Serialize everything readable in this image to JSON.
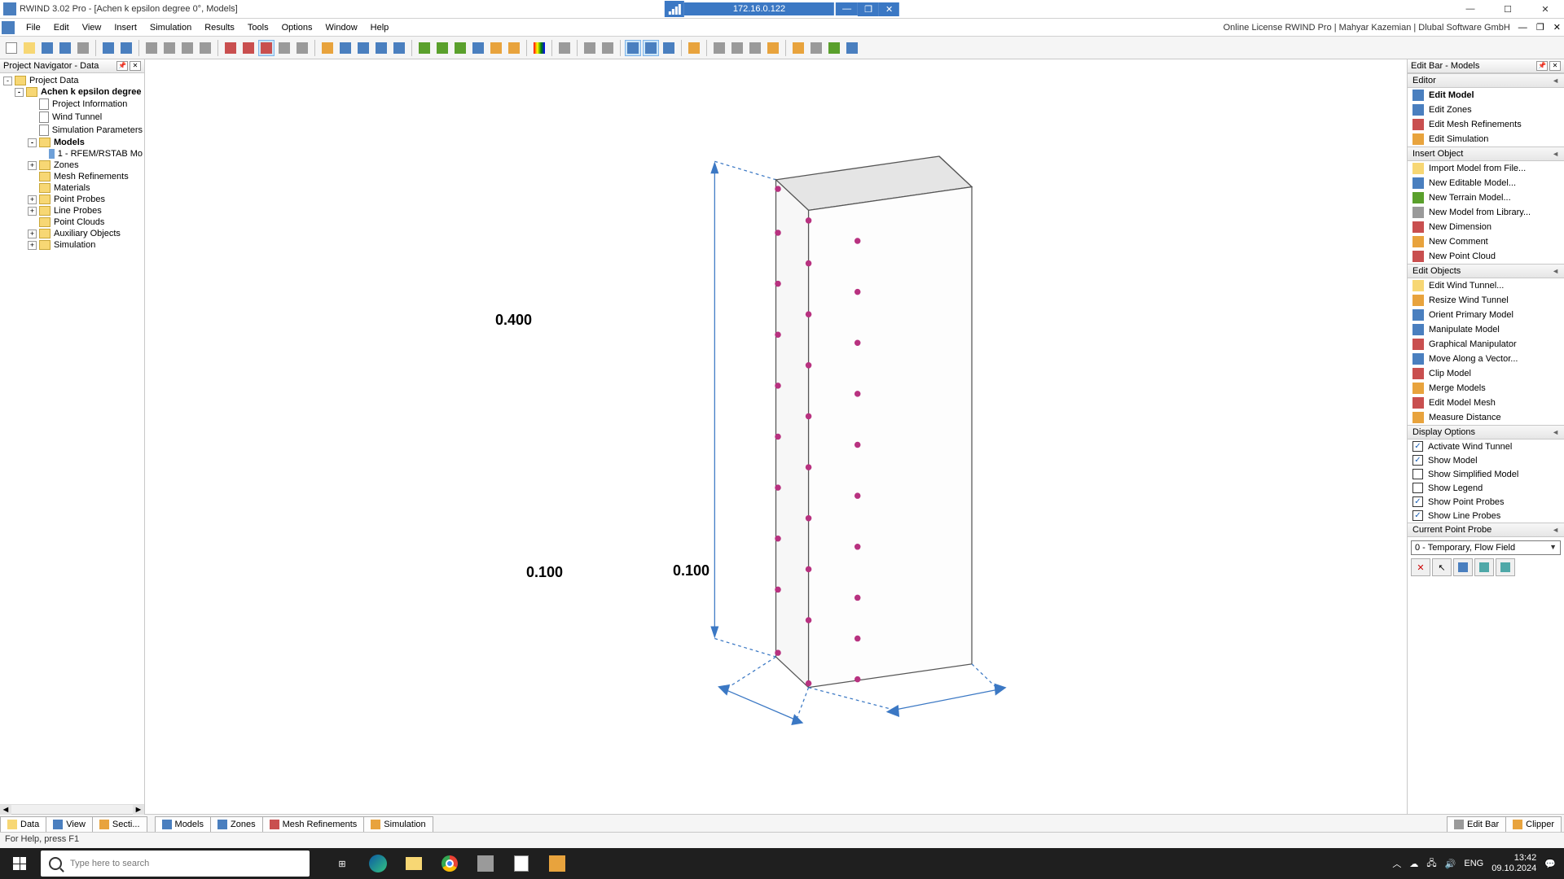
{
  "titlebar": {
    "app_title": "RWIND 3.02 Pro - [Achen  k epsilon degree 0°, Models]",
    "center_ip": "172.16.0.122"
  },
  "menubar": {
    "items": [
      "File",
      "Edit",
      "View",
      "Insert",
      "Simulation",
      "Results",
      "Tools",
      "Options",
      "Window",
      "Help"
    ],
    "license": "Online License RWIND Pro | Mahyar Kazemian | Dlubal Software GmbH"
  },
  "left_panel": {
    "title": "Project Navigator - Data",
    "tree": [
      {
        "level": 0,
        "icon": "folder",
        "label": "Project Data",
        "expander": "-"
      },
      {
        "level": 1,
        "icon": "folder",
        "label": "Achen  k epsilon degree",
        "expander": "-",
        "bold": true
      },
      {
        "level": 2,
        "icon": "doc",
        "label": "Project Information",
        "expander": ""
      },
      {
        "level": 2,
        "icon": "doc",
        "label": "Wind Tunnel",
        "expander": ""
      },
      {
        "level": 2,
        "icon": "doc",
        "label": "Simulation Parameters",
        "expander": ""
      },
      {
        "level": 2,
        "icon": "folder",
        "label": "Models",
        "expander": "-",
        "bold": true
      },
      {
        "level": 3,
        "icon": "cube",
        "label": "1 - RFEM/RSTAB Mo",
        "expander": ""
      },
      {
        "level": 2,
        "icon": "folder",
        "label": "Zones",
        "expander": "+"
      },
      {
        "level": 2,
        "icon": "folder",
        "label": "Mesh Refinements",
        "expander": ""
      },
      {
        "level": 2,
        "icon": "folder",
        "label": "Materials",
        "expander": ""
      },
      {
        "level": 2,
        "icon": "folder",
        "label": "Point Probes",
        "expander": "+"
      },
      {
        "level": 2,
        "icon": "folder",
        "label": "Line Probes",
        "expander": "+"
      },
      {
        "level": 2,
        "icon": "folder",
        "label": "Point Clouds",
        "expander": ""
      },
      {
        "level": 2,
        "icon": "folder",
        "label": "Auxiliary Objects",
        "expander": "+"
      },
      {
        "level": 2,
        "icon": "folder",
        "label": "Simulation",
        "expander": "+"
      }
    ]
  },
  "viewport": {
    "dim_height": "0.400",
    "dim_width": "0.100",
    "dim_depth": "0.100"
  },
  "right_panel": {
    "title": "Edit Bar - Models",
    "editor": {
      "header": "Editor",
      "items": [
        {
          "label": "Edit Model",
          "bold": true,
          "color": "#4a7fbf"
        },
        {
          "label": "Edit Zones",
          "color": "#4a7fbf"
        },
        {
          "label": "Edit Mesh Refinements",
          "color": "#c94f4f"
        },
        {
          "label": "Edit Simulation",
          "color": "#e8a33d"
        }
      ]
    },
    "insert": {
      "header": "Insert Object",
      "items": [
        {
          "label": "Import Model from File...",
          "color": "#f7d774"
        },
        {
          "label": "New Editable Model...",
          "color": "#4a7fbf"
        },
        {
          "label": "New Terrain Model...",
          "color": "#5aa02c"
        },
        {
          "label": "New Model from Library...",
          "color": "#9a9a9a"
        },
        {
          "label": "New Dimension",
          "color": "#c94f4f"
        },
        {
          "label": "New Comment",
          "color": "#e8a33d"
        },
        {
          "label": "New Point Cloud",
          "color": "#c94f4f"
        }
      ]
    },
    "edit_objects": {
      "header": "Edit Objects",
      "items": [
        {
          "label": "Edit Wind Tunnel...",
          "color": "#f7d774"
        },
        {
          "label": "Resize Wind Tunnel",
          "color": "#e8a33d"
        },
        {
          "label": "Orient Primary Model",
          "color": "#4a7fbf"
        },
        {
          "label": "Manipulate Model",
          "color": "#4a7fbf"
        },
        {
          "label": "Graphical Manipulator",
          "color": "#c94f4f"
        },
        {
          "label": "Move Along a Vector...",
          "color": "#4a7fbf"
        },
        {
          "label": "Clip Model",
          "color": "#c94f4f"
        },
        {
          "label": "Merge Models",
          "color": "#e8a33d"
        },
        {
          "label": "Edit Model Mesh",
          "color": "#c94f4f"
        },
        {
          "label": "Measure Distance",
          "color": "#e8a33d"
        }
      ]
    },
    "display": {
      "header": "Display Options",
      "items": [
        {
          "label": "Activate Wind Tunnel",
          "checked": true
        },
        {
          "label": "Show Model",
          "checked": true
        },
        {
          "label": "Show Simplified Model",
          "checked": false
        },
        {
          "label": "Show Legend",
          "checked": false
        },
        {
          "label": "Show Point Probes",
          "checked": true
        },
        {
          "label": "Show Line Probes",
          "checked": true
        }
      ]
    },
    "probe": {
      "header": "Current Point Probe",
      "combo": "0 - Temporary, Flow Field"
    }
  },
  "bottom_tabs": {
    "left_group": [
      "Data",
      "View",
      "Secti..."
    ],
    "mid_group": [
      "Models",
      "Zones",
      "Mesh Refinements",
      "Simulation"
    ],
    "right_group": [
      "Edit Bar",
      "Clipper"
    ]
  },
  "statusbar": {
    "text": "For Help, press F1"
  },
  "taskbar": {
    "search_placeholder": "Type here to search",
    "lang": "ENG",
    "time": "13:42",
    "date": "09.10.2024"
  }
}
